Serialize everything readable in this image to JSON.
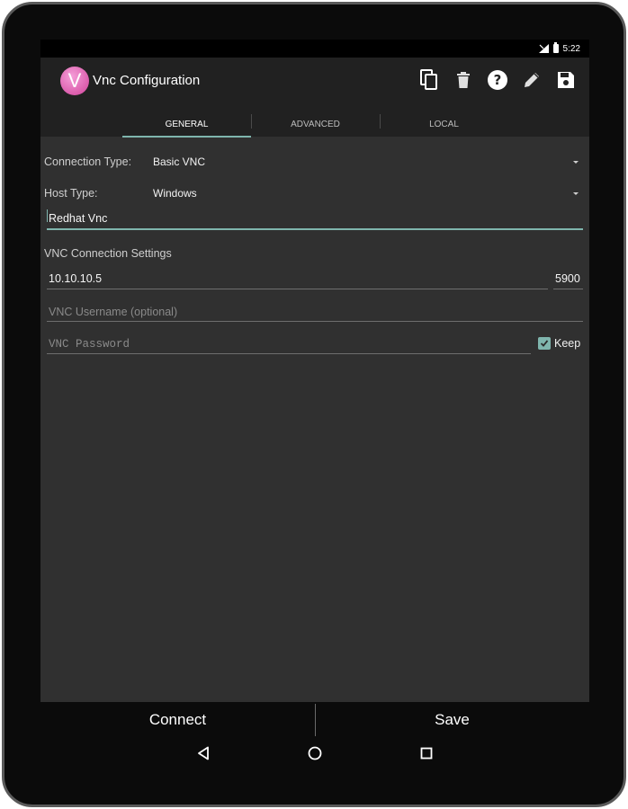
{
  "status_bar": {
    "time": "5:22"
  },
  "app_bar": {
    "logo_letter": "V",
    "title": "Vnc Configuration",
    "actions": [
      {
        "name": "copy-icon"
      },
      {
        "name": "delete-icon"
      },
      {
        "name": "help-icon"
      },
      {
        "name": "edit-icon"
      },
      {
        "name": "save-icon"
      }
    ]
  },
  "tabs": [
    {
      "label": "GENERAL",
      "active": true
    },
    {
      "label": "ADVANCED",
      "active": false
    },
    {
      "label": "LOCAL",
      "active": false
    }
  ],
  "form": {
    "connection_type": {
      "label": "Connection Type:",
      "value": "Basic VNC"
    },
    "host_type": {
      "label": "Host Type:",
      "value": "Windows"
    },
    "nickname": {
      "value": "Redhat Vnc"
    },
    "section_title": "VNC Connection Settings",
    "host": {
      "value": "10.10.10.5"
    },
    "port": {
      "value": "5900"
    },
    "username": {
      "placeholder": "VNC Username (optional)"
    },
    "password": {
      "placeholder": "VNC Password"
    },
    "keep_password": {
      "label": "Keep",
      "checked": true
    }
  },
  "bottom_buttons": {
    "connect": "Connect",
    "save": "Save"
  },
  "colors": {
    "accent": "#7fb5ad",
    "background": "#303030",
    "toolbar": "#212121"
  }
}
